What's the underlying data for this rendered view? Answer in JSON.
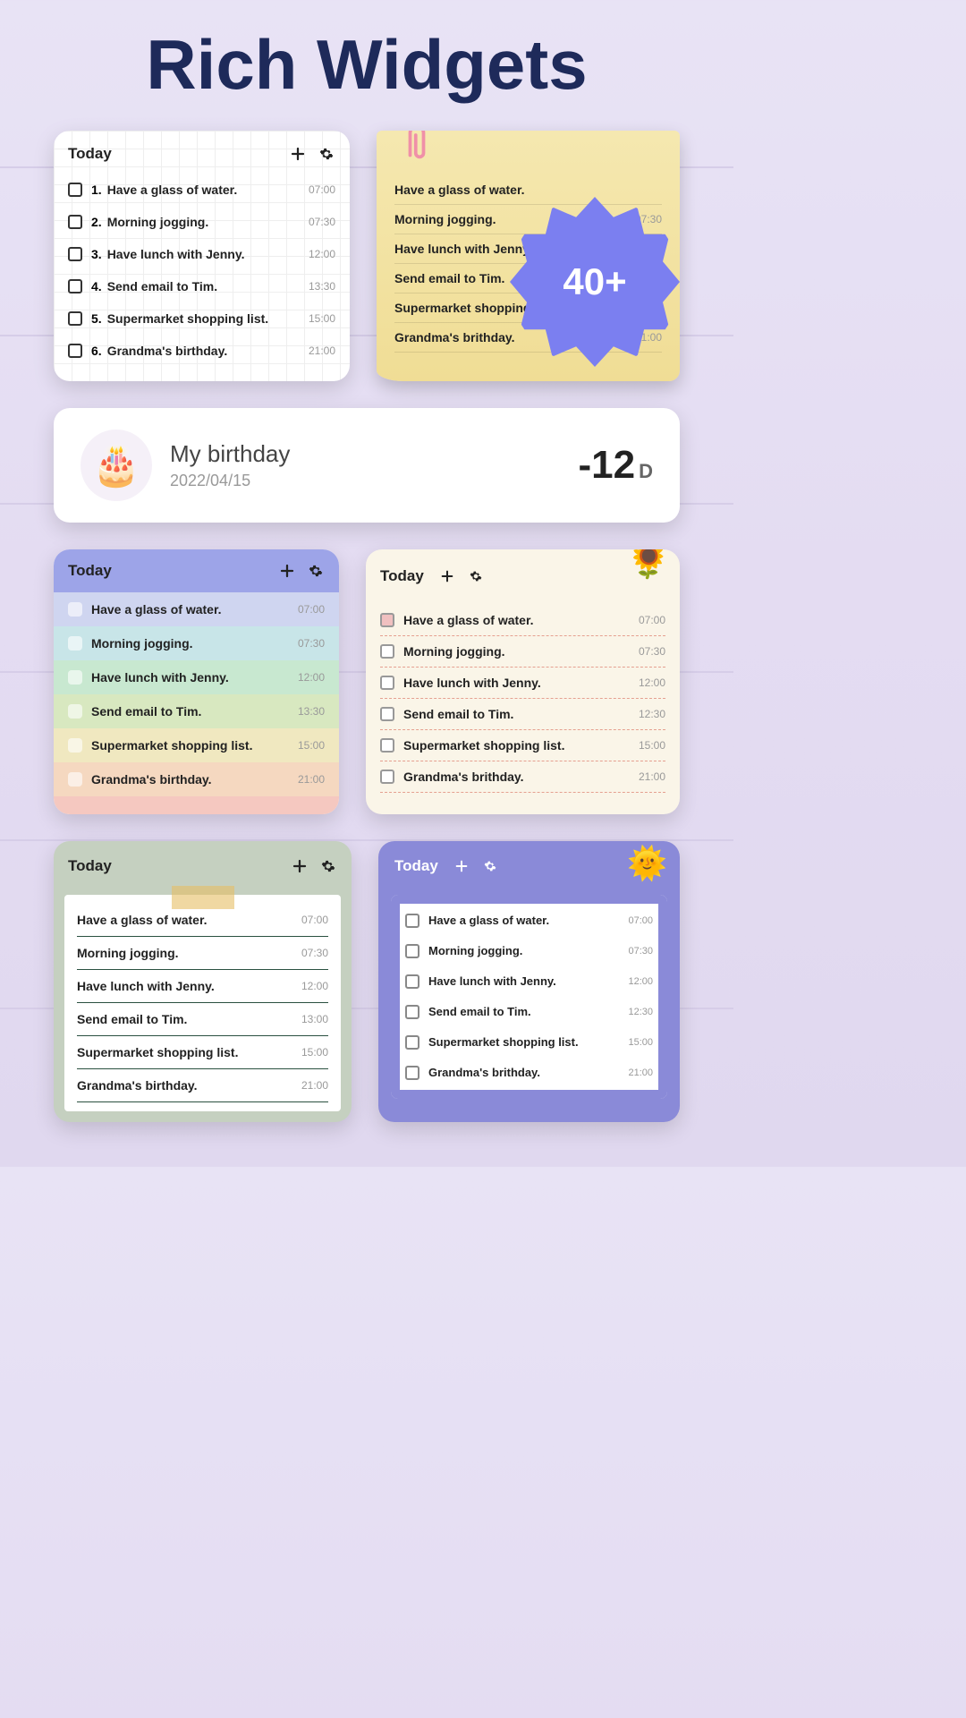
{
  "title": "Rich Widgets",
  "badge": "40+",
  "todayLabel": "Today",
  "tasks": [
    {
      "n": "1.",
      "text": "Have a glass of water.",
      "time": "07:00",
      "hl": "hl-pink"
    },
    {
      "n": "2.",
      "text": "Morning jogging.",
      "time": "07:30",
      "hl": "hl-yellow"
    },
    {
      "n": "3.",
      "text": "Have lunch with Jenny.",
      "time": "12:00",
      "hl": "hl-green"
    },
    {
      "n": "4.",
      "text": "Send email to Tim.",
      "time": "13:30",
      "hl": "hl-blue"
    },
    {
      "n": "5.",
      "text": "Supermarket shopping list.",
      "time": "15:00",
      "hl": "hl-purple"
    },
    {
      "n": "6.",
      "text": "Grandma's birthday.",
      "time": "21:00",
      "hl": "hl-lpink"
    }
  ],
  "tasksAlt": [
    {
      "text": "Have a glass of water.",
      "time": "07:00"
    },
    {
      "text": "Morning jogging.",
      "time": "07:30"
    },
    {
      "text": "Have lunch with Jenny.",
      "time": "12:00"
    },
    {
      "text": "Send email to Tim.",
      "time": "12:30"
    },
    {
      "text": "Supermarket shopping list.",
      "time": "15:00"
    },
    {
      "text": "Grandma's brithday.",
      "time": "21:00"
    }
  ],
  "tasksW6": [
    {
      "text": "Have a glass of water.",
      "time": "07:00"
    },
    {
      "text": "Morning jogging.",
      "time": "07:30"
    },
    {
      "text": "Have lunch with Jenny.",
      "time": "12:00"
    },
    {
      "text": "Send email to Tim.",
      "time": "13:00"
    },
    {
      "text": "Supermarket shopping list.",
      "time": "15:00"
    },
    {
      "text": "Grandma's birthday.",
      "time": "21:00"
    }
  ],
  "countdown": {
    "title": "My birthday",
    "date": "2022/04/15",
    "days": "-12",
    "unit": "D"
  }
}
